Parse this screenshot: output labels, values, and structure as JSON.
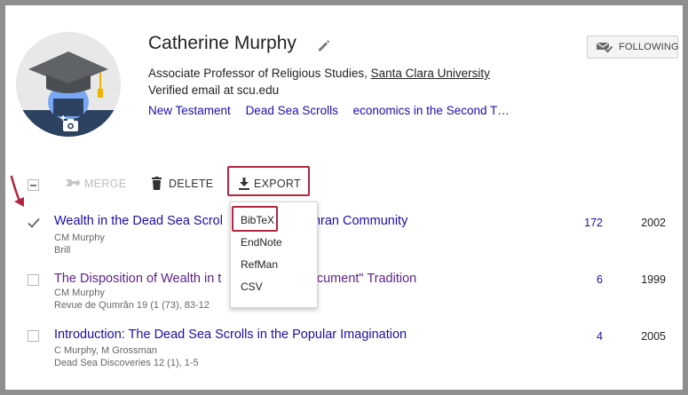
{
  "profile": {
    "name": "Catherine Murphy",
    "affiliation_prefix": "Associate Professor of Religious Studies, ",
    "affiliation_org": "Santa Clara University",
    "email": "Verified email at scu.edu",
    "interests": [
      "New Testament",
      "Dead Sea Scrolls",
      "economics in the Second T…"
    ],
    "follow_label": "FOLLOWING"
  },
  "toolbar": {
    "merge_label": "MERGE",
    "delete_label": "DELETE",
    "export_label": "EXPORT"
  },
  "export_menu": {
    "items": [
      "BibTeX",
      "EndNote",
      "RefMan",
      "CSV"
    ]
  },
  "articles": [
    {
      "title_left": "Wealth in the Dead Sea Scrol",
      "title_right": "mran Community",
      "authors": "CM Murphy",
      "venue": "Brill",
      "cited": "172",
      "year": "2002",
      "checked": true
    },
    {
      "title_left": "The Disposition of Wealth in t",
      "title_right": "Document\" Tradition",
      "authors": "CM Murphy",
      "venue": "Revue de Qumrân 19 (1 (73), 83-12",
      "cited": "6",
      "year": "1999",
      "checked": false
    },
    {
      "title": "Introduction: The Dead Sea Scrolls in the Popular Imagination",
      "authors": "C Murphy, M Grossman",
      "venue": "Dead Sea Discoveries 12 (1), 1-5",
      "cited": "4",
      "year": "2005",
      "checked": false
    }
  ],
  "colors": {
    "link": "#1a0dab",
    "visited": "#5e1f8a",
    "highlight": "#b2263f"
  }
}
